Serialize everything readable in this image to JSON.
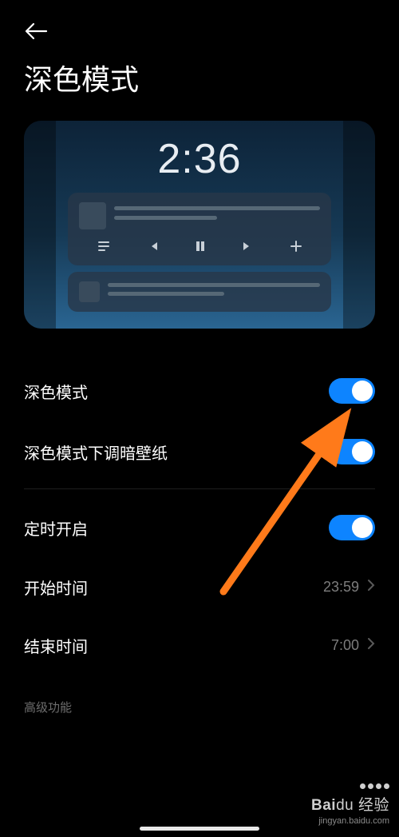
{
  "header": {
    "page_title": "深色模式"
  },
  "preview": {
    "clock": "2:36"
  },
  "settings": {
    "dark_mode": {
      "label": "深色模式",
      "on": true
    },
    "dim_wallpaper": {
      "label": "深色模式下调暗壁纸",
      "on": true
    },
    "schedule": {
      "label": "定时开启",
      "on": true
    },
    "start_time": {
      "label": "开始时间",
      "value": "23:59"
    },
    "end_time": {
      "label": "结束时间",
      "value": "7:00"
    }
  },
  "sections": {
    "advanced": "高级功能"
  },
  "watermark": {
    "brand_prefix": "Bai",
    "brand_suffix": "经验",
    "url": "jingyan.baidu.com"
  },
  "colors": {
    "accent": "#0d84ff",
    "arrow": "#ff7a1a"
  }
}
